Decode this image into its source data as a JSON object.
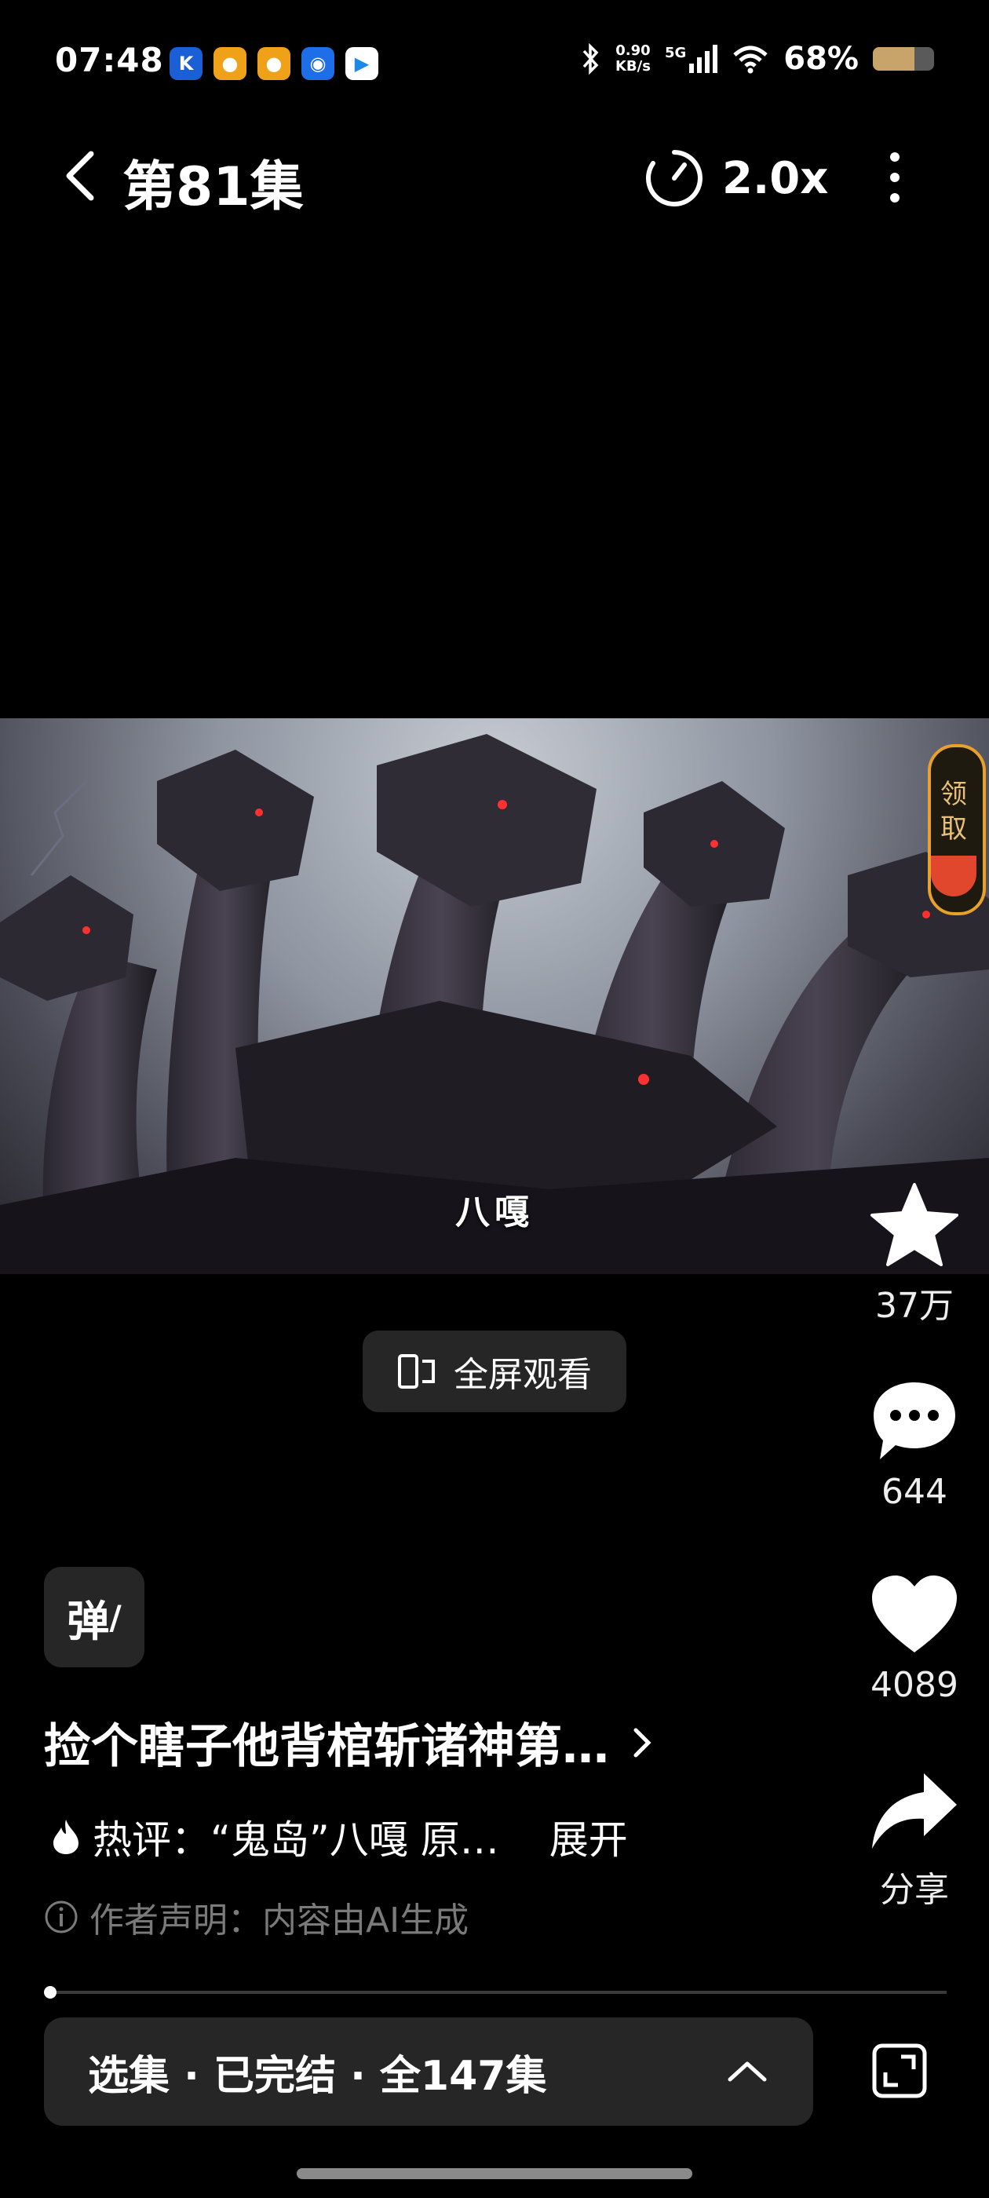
{
  "status_bar": {
    "time": "07:48",
    "net_speed_value": "0.90",
    "net_speed_unit": "KB/s",
    "network": "5G",
    "battery": "68%",
    "battery_level": 0.68,
    "app_icons": [
      "k-app-icon",
      "weibo-icon",
      "weibo-icon",
      "qq-browser-icon",
      "video-app-icon"
    ]
  },
  "nav": {
    "episode_title": "第81集",
    "speed": "2.0x"
  },
  "video": {
    "subtitle": "八嘎",
    "reward_label": "领取"
  },
  "fullscreen_label": "全屏观看",
  "actions": {
    "favorite_count": "37万",
    "comment_count": "644",
    "like_count": "4089",
    "share_label": "分享"
  },
  "info": {
    "danmaku_label": "弹",
    "series_title": "捡个瞎子他背棺斩诸神第…",
    "hot_comment": "热评：“鬼岛”八嘎 原…",
    "expand_label": "展开",
    "disclaimer": "作者声明：内容由AI生成"
  },
  "progress": {
    "fraction": 0.0
  },
  "episode_bar": {
    "label": "选集 · 已完结 · 全147集"
  },
  "colors": {
    "background": "#000000",
    "panel": "#262626",
    "reward_border": "#e8a22a",
    "muted_text": "#7a7a7a"
  }
}
